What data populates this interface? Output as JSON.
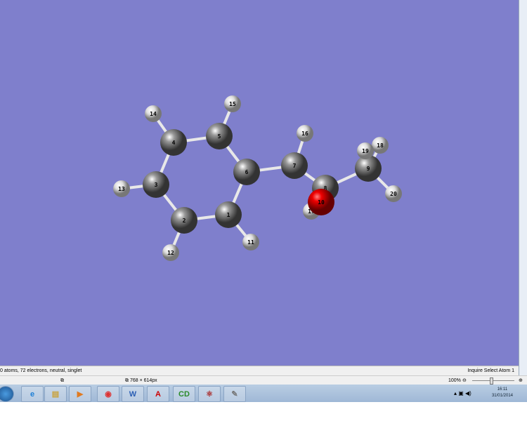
{
  "molecule": {
    "atoms": [
      {
        "label": "1",
        "element": "C"
      },
      {
        "label": "2",
        "element": "C"
      },
      {
        "label": "3",
        "element": "C"
      },
      {
        "label": "4",
        "element": "C"
      },
      {
        "label": "5",
        "element": "C"
      },
      {
        "label": "6",
        "element": "C"
      },
      {
        "label": "7",
        "element": "C"
      },
      {
        "label": "8",
        "element": "C"
      },
      {
        "label": "9",
        "element": "C"
      },
      {
        "label": "10",
        "element": "O"
      },
      {
        "label": "11",
        "element": "H"
      },
      {
        "label": "12",
        "element": "H"
      },
      {
        "label": "13",
        "element": "H"
      },
      {
        "label": "14",
        "element": "H"
      },
      {
        "label": "15",
        "element": "H"
      },
      {
        "label": "16",
        "element": "H"
      },
      {
        "label": "17",
        "element": "H"
      },
      {
        "label": "18",
        "element": "H"
      },
      {
        "label": "19",
        "element": "H"
      },
      {
        "label": "20",
        "element": "H"
      }
    ],
    "bonds": [
      [
        1,
        2
      ],
      [
        2,
        3
      ],
      [
        3,
        4
      ],
      [
        4,
        5
      ],
      [
        5,
        6
      ],
      [
        6,
        1
      ],
      [
        6,
        7
      ],
      [
        7,
        8
      ],
      [
        8,
        9
      ],
      [
        8,
        10
      ],
      [
        10,
        17
      ],
      [
        7,
        16
      ],
      [
        9,
        18
      ],
      [
        9,
        19
      ],
      [
        9,
        20
      ],
      [
        1,
        11
      ],
      [
        2,
        12
      ],
      [
        3,
        13
      ],
      [
        4,
        14
      ],
      [
        5,
        15
      ]
    ],
    "colors": {
      "C": "#8a8a8a",
      "O": "#e00000",
      "H": "#e6e6e6",
      "background": "#7f7fcc"
    }
  },
  "status": {
    "left": "0 atoms, 72 electrons, neutral, singlet",
    "mode": "Inquire",
    "action": "Select Atom 1"
  },
  "bar2": {
    "size": "768 × 614px",
    "zoom": "100%"
  },
  "taskbar": {
    "apps": [
      "start",
      "ie",
      "explorer",
      "media",
      "chrome",
      "word",
      "acrobat",
      "chemdraw",
      "gaussview",
      "paint"
    ],
    "time": "16:11",
    "date": "31/01/2014"
  }
}
